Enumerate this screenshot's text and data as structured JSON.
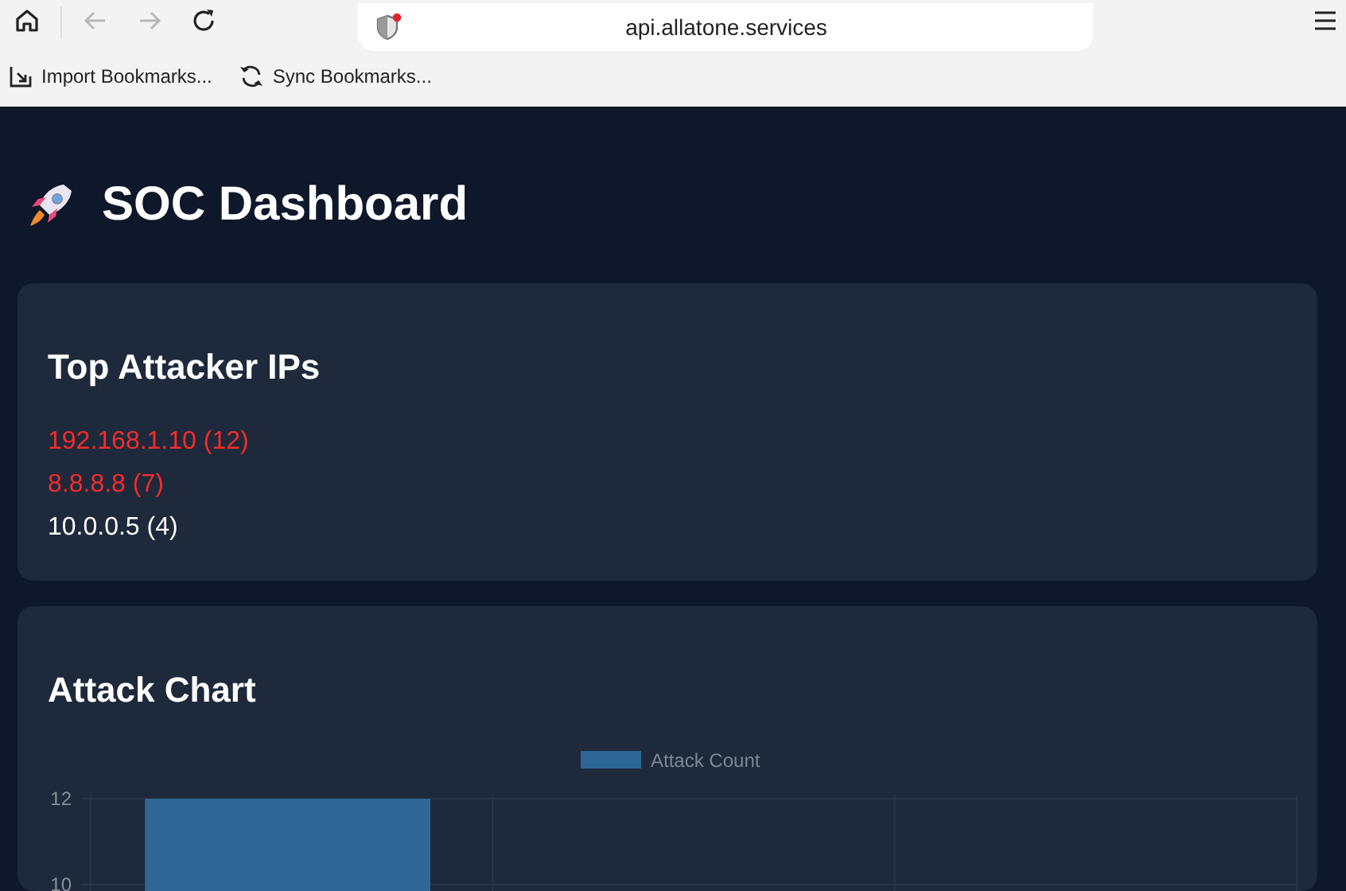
{
  "browser": {
    "address": "api.allatone.services",
    "back_disabled": true,
    "forward_disabled": true,
    "bookmarks": [
      "Import Bookmarks...",
      "Sync Bookmarks..."
    ]
  },
  "page": {
    "title": "SOC Dashboard"
  },
  "top_attackers": {
    "title": "Top Attacker IPs",
    "items": [
      {
        "text": "192.168.1.10 (12)",
        "color": "#f52c2c"
      },
      {
        "text": "8.8.8.8 (7)",
        "color": "#f52c2c"
      },
      {
        "text": "10.0.0.5 (4)",
        "color": "#ffffff"
      }
    ]
  },
  "attack_chart": {
    "title": "Attack Chart",
    "chart_data": {
      "type": "bar",
      "ylim": [
        0,
        12
      ],
      "yticks": [
        10,
        12
      ],
      "series": [
        {
          "name": "Attack Count",
          "color": "#2e6796",
          "values": [
            12,
            null,
            null
          ]
        }
      ]
    }
  }
}
